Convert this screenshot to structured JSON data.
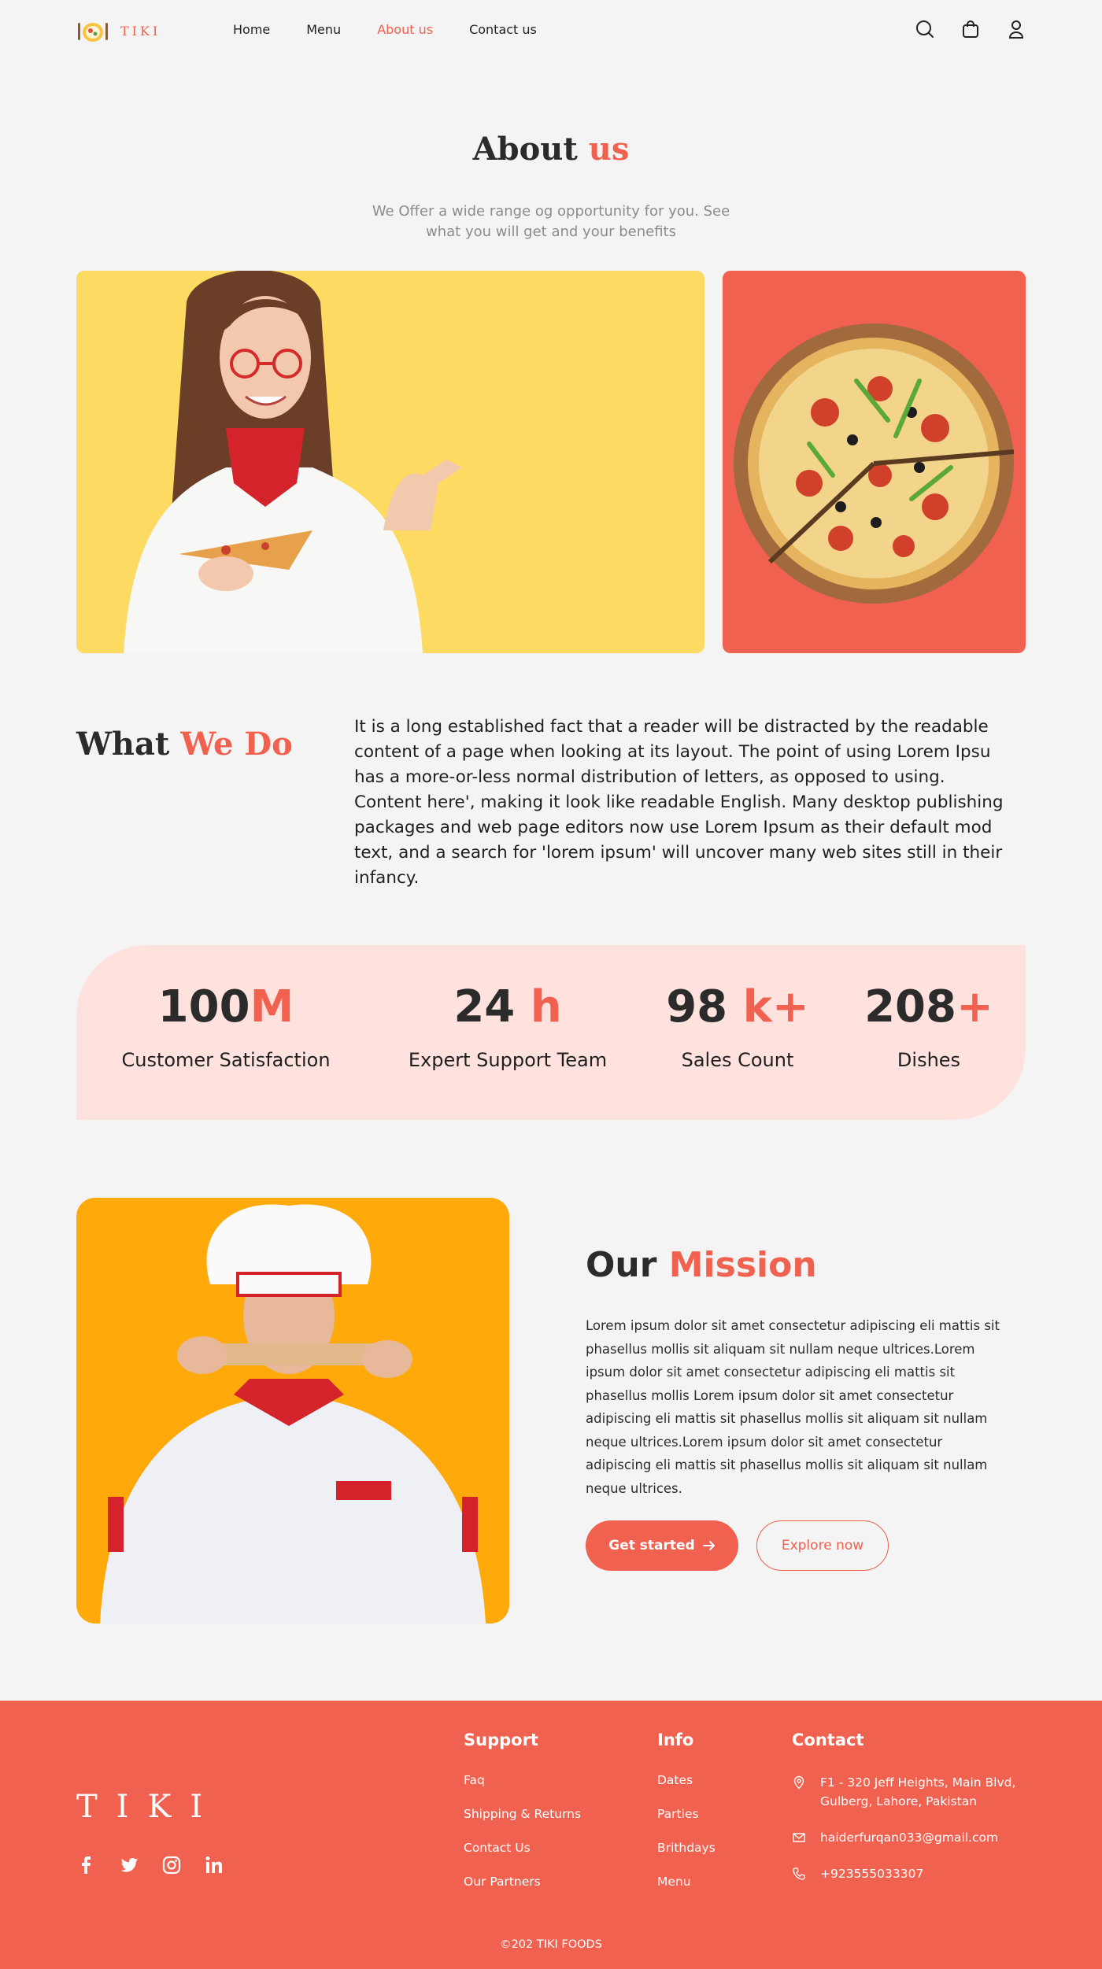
{
  "brand": {
    "name": "TIKI",
    "accent": "#f06150"
  },
  "nav": {
    "items": [
      {
        "label": "Home",
        "active": false
      },
      {
        "label": "Menu",
        "active": false
      },
      {
        "label": "About us",
        "active": true
      },
      {
        "label": "Contact us",
        "active": false
      }
    ],
    "icons": [
      "search-icon",
      "shopping-bag-icon",
      "user-icon"
    ]
  },
  "hero": {
    "title_main": "About",
    "title_accent": "us",
    "subtitle": "We Offer a wide range og opportunity for you. See what you will get and your benefits"
  },
  "what_we_do": {
    "title_main": "What",
    "title_accent": "We Do",
    "body": "It is a long established fact that a reader will be distracted by the readable content of a page when looking at its layout. The point of using Lorem Ipsu  has a more-or-less normal distribution of letters, as opposed to using. Content here', making it look like readable English. Many desktop publishing packages and web page editors now use Lorem Ipsum as their default mod text, and a search for 'lorem ipsum' will uncover many web sites still in their infancy."
  },
  "stats": [
    {
      "number": "100",
      "suffix": "M",
      "label": "Customer Satisfaction"
    },
    {
      "number": "24",
      "suffix": " h",
      "label": "Expert Support Team"
    },
    {
      "number": "98",
      "suffix": " k+",
      "label": "Sales Count"
    },
    {
      "number": "208",
      "suffix": "+",
      "label": "Dishes"
    }
  ],
  "mission": {
    "title_main": "Our",
    "title_accent": "Mission",
    "body": "Lorem ipsum dolor sit amet consectetur adipiscing eli mattis sit phasellus mollis sit aliquam sit nullam neque ultrices.Lorem ipsum dolor sit amet consectetur adipiscing eli mattis sit phasellus mollis Lorem ipsum dolor sit amet consectetur adipiscing eli mattis sit phasellus mollis sit aliquam sit nullam neque ultrices.Lorem ipsum dolor sit amet consectetur adipiscing eli mattis sit phasellus mollis sit aliquam sit nullam neque ultrices.",
    "primary_button": "Get started",
    "secondary_button": "Explore now"
  },
  "footer": {
    "logo": "TIKI",
    "socials": [
      "facebook-icon",
      "twitter-icon",
      "instagram-icon",
      "linkedin-icon"
    ],
    "support": {
      "heading": "Support",
      "links": [
        "Faq",
        "Shipping & Returns",
        "Contact Us",
        "Our Partners"
      ]
    },
    "info": {
      "heading": "Info",
      "links": [
        "Dates",
        "Parties",
        "Brithdays",
        "Menu"
      ]
    },
    "contact": {
      "heading": "Contact",
      "address": "F1 - 320 Jeff Heights, Main Blvd, Gulberg, Lahore, Pakistan",
      "email": "haiderfurqan033@gmail.com",
      "phone": "+923555033307"
    },
    "copyright": "©202 TIKI FOODS"
  }
}
